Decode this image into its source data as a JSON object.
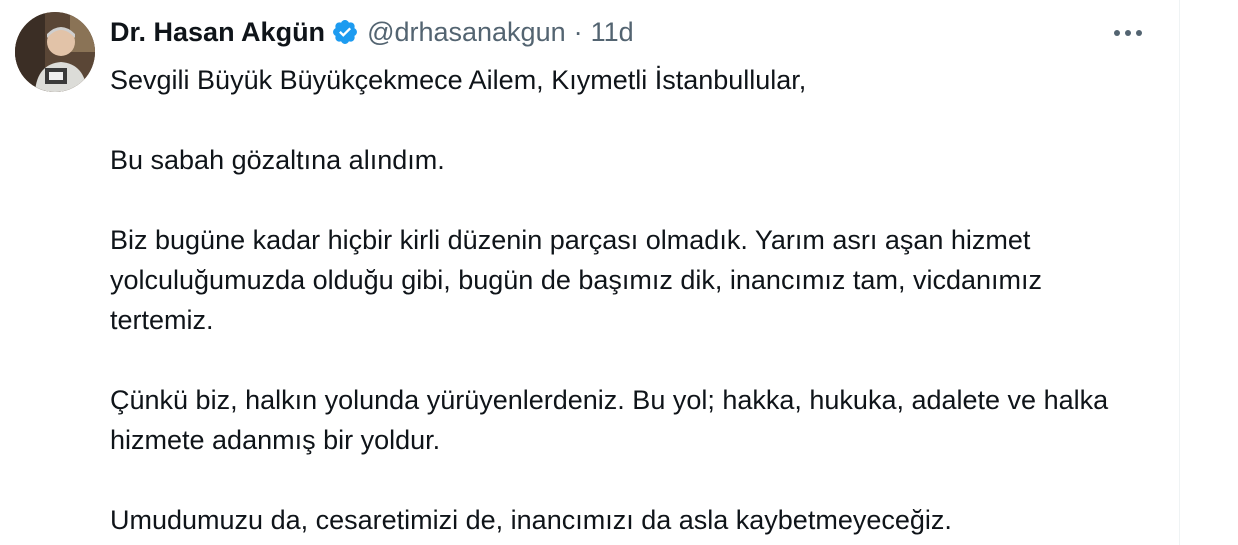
{
  "tweet": {
    "author_name": "Dr. Hasan Akgün",
    "handle": "@drhasanakgun",
    "separator": "·",
    "time": "11d",
    "verified": true,
    "accent_color": "#1d9bf0",
    "paragraphs": [
      "Sevgili Büyük Büyükçekmece Ailem, Kıymetli İstanbullular,",
      "Bu sabah gözaltına alındım.",
      "Biz bugüne kadar hiçbir kirli düzenin parçası olmadık. Yarım asrı aşan hizmet yolculuğumuzda olduğu gibi, bugün de başımız dik, inancımız tam, vicdanımız tertemiz.",
      "Çünkü biz, halkın yolunda yürüyenlerdeniz. Bu yol; hakka, hukuka, adalete ve halka hizmete adanmış bir yoldur.",
      "Umudumuzu da, cesaretimizi de, inancımızı da asla kaybetmeyeceğiz."
    ]
  }
}
